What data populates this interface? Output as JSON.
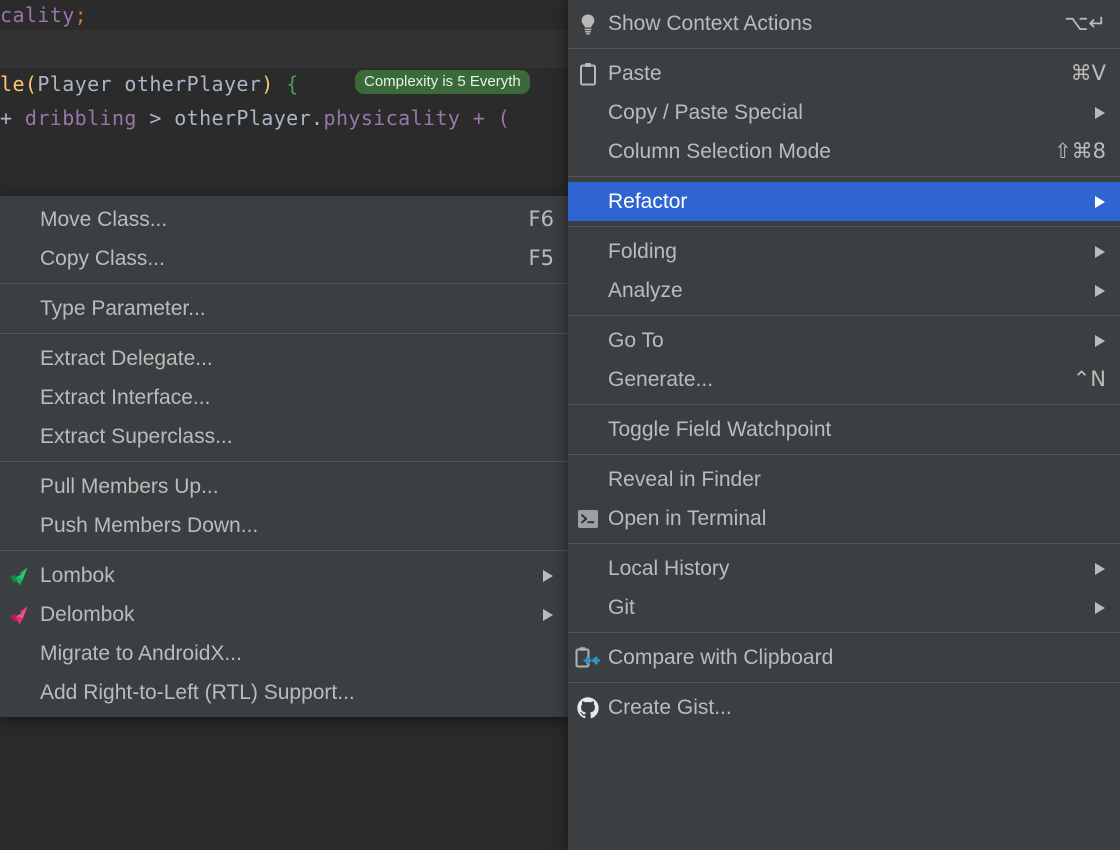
{
  "editor": {
    "line1": {
      "text": "cality",
      "terminator": ";"
    },
    "line2": {
      "seg1": "le",
      "paren_open": "(",
      "params": "Player otherPlayer",
      "paren_close": ")",
      "brace": "{"
    },
    "line3": {
      "plus": "+ ",
      "field": "dribbling",
      "op": " > ",
      "ref": "otherPlayer.",
      "field2": "physicality",
      "tail": " + ("
    },
    "inlay_hint": "Complexity is 5 Everyth"
  },
  "submenu_refactor": {
    "name": "Refactor",
    "groups": [
      {
        "items": [
          {
            "label": "Move Class...",
            "accel": "F6",
            "icon": null,
            "submenu": false
          },
          {
            "label": "Copy Class...",
            "accel": "F5",
            "icon": null,
            "submenu": false
          }
        ]
      },
      {
        "items": [
          {
            "label": "Type Parameter...",
            "accel": "",
            "icon": null,
            "submenu": false
          }
        ]
      },
      {
        "items": [
          {
            "label": "Extract Delegate...",
            "accel": "",
            "icon": null,
            "submenu": false
          },
          {
            "label": "Extract Interface...",
            "accel": "",
            "icon": null,
            "submenu": false
          },
          {
            "label": "Extract Superclass...",
            "accel": "",
            "icon": null,
            "submenu": false
          }
        ]
      },
      {
        "items": [
          {
            "label": "Pull Members Up...",
            "accel": "",
            "icon": null,
            "submenu": false
          },
          {
            "label": "Push Members Down...",
            "accel": "",
            "icon": null,
            "submenu": false
          }
        ]
      },
      {
        "items": [
          {
            "label": "Lombok",
            "accel": "",
            "icon": "lombok-bird-icon",
            "submenu": true
          },
          {
            "label": "Delombok",
            "accel": "",
            "icon": "delombok-bird-icon",
            "submenu": true
          },
          {
            "label": "Migrate to AndroidX...",
            "accel": "",
            "icon": null,
            "submenu": false
          },
          {
            "label": "Add Right-to-Left (RTL) Support...",
            "accel": "",
            "icon": null,
            "submenu": false
          }
        ]
      }
    ]
  },
  "context_menu": {
    "groups": [
      {
        "items": [
          {
            "label": "Show Context Actions",
            "accel": "⌥↵",
            "icon": "lightbulb-icon",
            "submenu": false,
            "selected": false
          }
        ]
      },
      {
        "items": [
          {
            "label": "Paste",
            "accel": "⌘V",
            "icon": "clipboard-icon",
            "submenu": false,
            "selected": false
          },
          {
            "label": "Copy / Paste Special",
            "accel": "",
            "icon": null,
            "submenu": true,
            "selected": false
          },
          {
            "label": "Column Selection Mode",
            "accel": "⇧⌘8",
            "icon": null,
            "submenu": false,
            "selected": false
          }
        ]
      },
      {
        "items": [
          {
            "label": "Refactor",
            "accel": "",
            "icon": null,
            "submenu": true,
            "selected": true
          }
        ]
      },
      {
        "items": [
          {
            "label": "Folding",
            "accel": "",
            "icon": null,
            "submenu": true,
            "selected": false
          },
          {
            "label": "Analyze",
            "accel": "",
            "icon": null,
            "submenu": true,
            "selected": false
          }
        ]
      },
      {
        "items": [
          {
            "label": "Go To",
            "accel": "",
            "icon": null,
            "submenu": true,
            "selected": false
          },
          {
            "label": "Generate...",
            "accel": "⌃N",
            "icon": null,
            "submenu": false,
            "selected": false
          }
        ]
      },
      {
        "items": [
          {
            "label": "Toggle Field Watchpoint",
            "accel": "",
            "icon": null,
            "submenu": false,
            "selected": false
          }
        ]
      },
      {
        "items": [
          {
            "label": "Reveal in Finder",
            "accel": "",
            "icon": null,
            "submenu": false,
            "selected": false
          },
          {
            "label": "Open in Terminal",
            "accel": "",
            "icon": "terminal-icon",
            "submenu": false,
            "selected": false
          }
        ]
      },
      {
        "items": [
          {
            "label": "Local History",
            "accel": "",
            "icon": null,
            "submenu": true,
            "selected": false
          },
          {
            "label": "Git",
            "accel": "",
            "icon": null,
            "submenu": true,
            "selected": false
          }
        ]
      },
      {
        "items": [
          {
            "label": "Compare with Clipboard",
            "accel": "",
            "icon": "compare-clipboard-icon",
            "submenu": false,
            "selected": false
          }
        ]
      },
      {
        "items": [
          {
            "label": "Create Gist...",
            "accel": "",
            "icon": "github-icon",
            "submenu": false,
            "selected": false
          }
        ]
      }
    ]
  },
  "colors": {
    "menu_bg": "#3c3f41",
    "selection_blue": "#2f65d0",
    "editor_bg": "#2b2b2b",
    "inlay_green": "#3a6a3a",
    "lombok_green": "#25b869",
    "delombok_pink": "#e8457c",
    "accent_blue": "#3592c4"
  }
}
